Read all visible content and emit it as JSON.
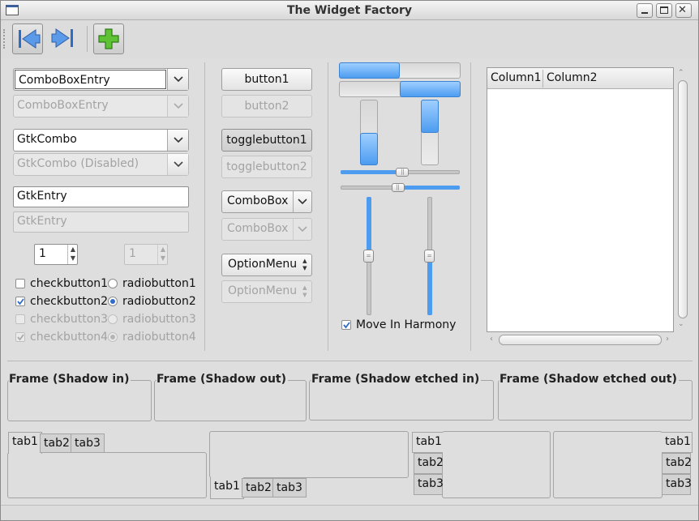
{
  "window": {
    "title": "The Widget Factory"
  },
  "col1": {
    "combo_entry": "ComboBoxEntry",
    "combo_entry_disabled": "ComboBoxEntry",
    "gtk_combo": "GtkCombo",
    "gtk_combo_disabled": "GtkCombo (Disabled)",
    "entry": "GtkEntry",
    "entry_disabled": "GtkEntry",
    "spin": "1",
    "spin_disabled": "1",
    "checks": [
      "checkbutton1",
      "checkbutton2",
      "checkbutton3",
      "checkbutton4"
    ],
    "radios": [
      "radiobutton1",
      "radiobutton2",
      "radiobutton3",
      "radiobutton4"
    ]
  },
  "col2": {
    "button1": "button1",
    "button2": "button2",
    "toggle1": "togglebutton1",
    "toggle2": "togglebutton2",
    "combobox": "ComboBox",
    "combobox_disabled": "ComboBox",
    "optionmenu": "OptionMenu",
    "optionmenu_disabled": "OptionMenu"
  },
  "col3": {
    "progress_h1": 0.5,
    "progress_h2": 0.5,
    "progress_v1": 0.5,
    "progress_v2": 0.5,
    "scale_h1": 0.52,
    "scale_h2": 0.48,
    "harmony": "Move In Harmony"
  },
  "tree": {
    "columns": [
      "Column1",
      "Column2"
    ]
  },
  "frames": [
    "Frame (Shadow in)",
    "Frame (Shadow out)",
    "Frame (Shadow etched in)",
    "Frame (Shadow etched out)"
  ],
  "tabs": [
    "tab1",
    "tab2",
    "tab3"
  ],
  "colors": {
    "accent": "#4d9cf0",
    "icon_green": "#4caf27"
  }
}
